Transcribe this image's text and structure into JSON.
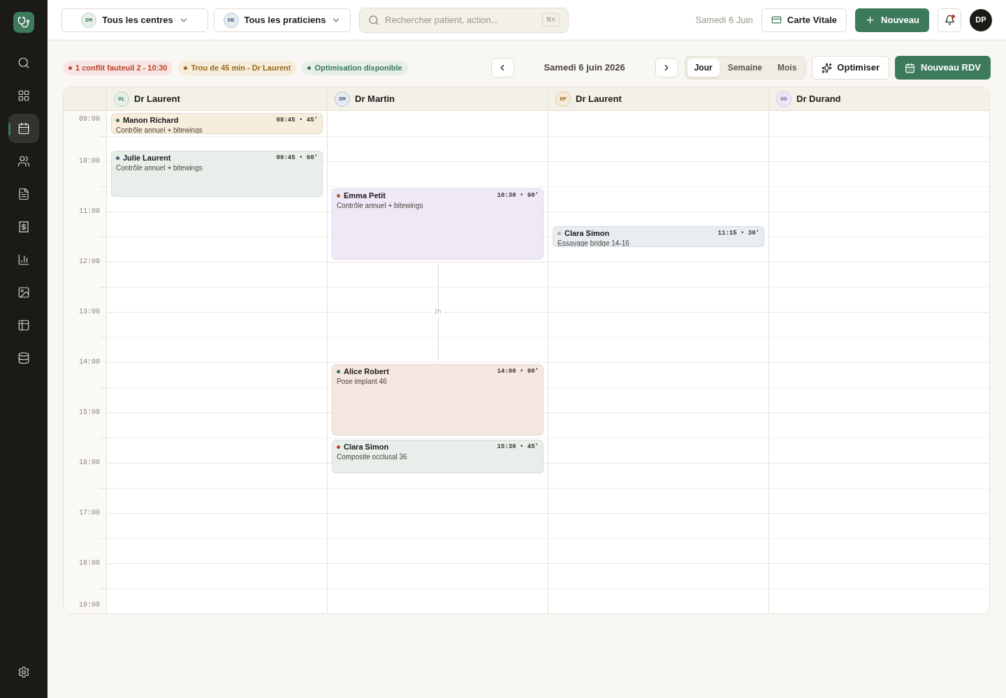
{
  "sidebar": {
    "items": [
      {
        "selected": false
      },
      {
        "selected": false
      },
      {
        "selected": true
      },
      {
        "selected": false
      },
      {
        "selected": false
      },
      {
        "selected": false
      },
      {
        "selected": false
      },
      {
        "selected": false
      },
      {
        "selected": false
      },
      {
        "selected": false
      }
    ]
  },
  "topbar": {
    "filters": [
      {
        "initials": "DM",
        "label": "Tous les centres"
      },
      {
        "initials": "DB",
        "label": "Tous les praticiens"
      }
    ],
    "search": {
      "placeholder": "Rechercher patient, action...",
      "shortcut": "⌘K"
    },
    "date": "Samedi 6 Juin",
    "card_button": "Carte Vitale",
    "new_button": "Nouveau",
    "notifications": {
      "unread": true
    },
    "avatar": "DP"
  },
  "alerts": [
    {
      "kind": "conflict",
      "text": "1 conflit fauteuil 2 - 10:30"
    },
    {
      "kind": "gap",
      "text": "Trou de 45 min - Dr Laurent"
    },
    {
      "kind": "optimization",
      "text": "Optimisation disponible"
    }
  ],
  "date_nav": {
    "label": "Samedi 6 juin 2026"
  },
  "views": [
    {
      "label": "Jour",
      "selected": true
    },
    {
      "label": "Semaine",
      "selected": false
    },
    {
      "label": "Mois",
      "selected": false
    }
  ],
  "optimize_button": "Optimiser",
  "new_appointment_button": "Nouveau RDV",
  "hours": [
    "09:00",
    "10:00",
    "11:00",
    "12:00",
    "13:00",
    "14:00",
    "15:00",
    "16:00",
    "17:00",
    "18:00",
    "19:00"
  ],
  "practitioners": [
    {
      "initials": "DL",
      "name": "Dr Laurent",
      "appointments": [
        {
          "patient": "Manon Richard",
          "time": "08:45 • 45'",
          "act": "Contrôle annuel + bitewings",
          "color": "#f6eddc",
          "status": {
            "color": "#3d7a5c"
          }
        },
        {
          "patient": "Julie Laurent",
          "time": "09:45 • 60'",
          "act": "Contrôle annuel + bitewings",
          "color": "#e8efea",
          "status": {
            "color": "#4a6382"
          }
        }
      ]
    },
    {
      "initials": "DM",
      "name": "Dr Martin",
      "appointments": [
        {
          "patient": "Emma Petit",
          "time": "10:30 • 90'",
          "act": "Contrôle annuel + bitewings",
          "color": "#efe8f7",
          "status": {
            "color": "#9a6a1e"
          }
        },
        {
          "patient": "Alice Robert",
          "time": "14:00 • 90'",
          "act": "Pose implant 46",
          "color": "#f6e7e2",
          "status": {
            "color": "#3d7a5c"
          },
          "gap_before": "2h"
        },
        {
          "patient": "Clara Simon",
          "time": "15:30 • 45'",
          "act": "Composite occlusal 36",
          "color": "#e8efea",
          "status": {
            "color": "#c0412f"
          }
        }
      ]
    },
    {
      "initials": "DP",
      "name": "Dr Laurent",
      "appointments": [
        {
          "patient": "Clara Simon",
          "time": "11:15 • 30'",
          "act": "Essayage bridge 14-16",
          "color": "#e8edf2",
          "status": {
            "color": "#b8b0a4"
          }
        }
      ]
    },
    {
      "initials": "DD",
      "name": "Dr Durand"
    }
  ]
}
